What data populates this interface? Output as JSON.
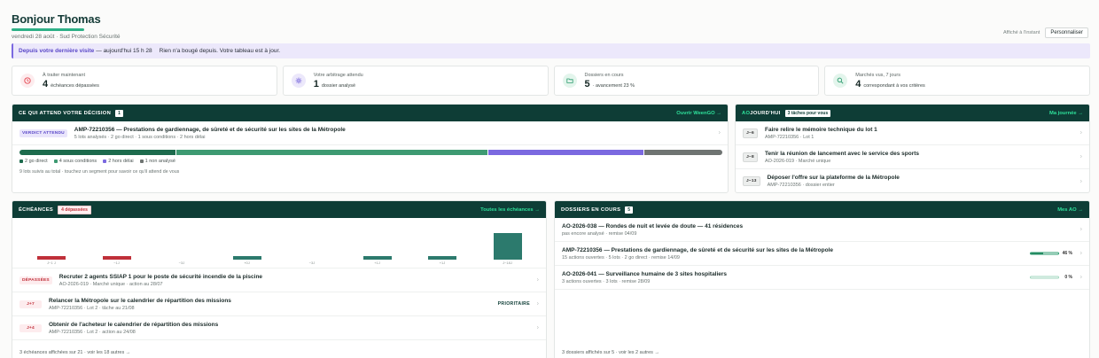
{
  "header": {
    "greeting": "Bonjour Thomas",
    "date": "vendredi 28 août · Sud Protection Sécurité",
    "stamp": "Affiché à l'instant",
    "customize_label": "Personnaliser"
  },
  "banner": {
    "strong": "Depuis votre dernière visite",
    "time": "— aujourd'hui 15 h 28",
    "message": "Rien n'a bougé depuis. Votre tableau est à jour."
  },
  "kpis": [
    {
      "label": "À traiter maintenant",
      "value": "4",
      "sub": "échéances dépassées",
      "icon": "clock-icon",
      "color": "#e54c56",
      "bg": "#fdecee"
    },
    {
      "label": "Votre arbitrage attendu",
      "value": "1",
      "sub": "dossier analysé",
      "icon": "gear-icon",
      "color": "#6a58d8",
      "bg": "#ece8fb"
    },
    {
      "label": "Dossiers en cours",
      "value": "5",
      "sub": "· avancement 23 %",
      "icon": "folder-icon",
      "color": "#2a9a6d",
      "bg": "#e3f5ec"
    },
    {
      "label": "Marchés vus, 7 jours",
      "value": "4",
      "sub": "correspondant à vos critères",
      "icon": "search-icon",
      "color": "#2a9a6d",
      "bg": "#e3f5ec"
    }
  ],
  "decision": {
    "title": "CE QUI ATTEND VOTRE DÉCISION",
    "count": "1",
    "link": "Ouvrir WeenGO →",
    "badge": "VERDICT ATTENDU",
    "row_title": "AMP-72210356 — Prestations de gardiennage, de sûreté et de sécurité sur les sites de la Métropole",
    "row_sub": "5 lots analysés · 2 go direct · 1 sous conditions · 2 hors délai",
    "legend": [
      "2 go direct",
      "4 sous conditions",
      "2 hors délai",
      "1 non analysé"
    ],
    "segments": [
      {
        "share": 2,
        "color": "#1d6b4d"
      },
      {
        "share": 4,
        "color": "#3e9a72"
      },
      {
        "share": 2,
        "color": "#7b69e0"
      },
      {
        "share": 1,
        "color": "#6f7472"
      }
    ],
    "note": "9 lots suivis au total · touchez un segment pour savoir ce qu'il attend de vous"
  },
  "today": {
    "title_hl": "AO",
    "title": "JOURD'HUI",
    "tag": "3 tâches pour vous",
    "link": "Ma journée →",
    "items": [
      {
        "badge": "J−6",
        "title": "Faire relire le mémoire technique du lot 1",
        "sub": "AMP-72210356 · Lot 1"
      },
      {
        "badge": "J−8",
        "title": "Tenir la réunion de lancement avec le service des sports",
        "sub": "AO-2026-019 · Marché unique"
      },
      {
        "badge": "J−13",
        "title": "Déposer l'offre sur la plateforme de la Métropole",
        "sub": "AMP-72210356 · dossier entier"
      }
    ]
  },
  "deadlines": {
    "title": "ÉCHÉANCES",
    "tag": "4 dépassées",
    "link": "Toutes les échéances →",
    "chart_data": {
      "type": "bar",
      "categories": [
        "J−1 J",
        "−1J",
        "−3J",
        "+0J",
        "−3J",
        "+1J",
        "+1J",
        "J−18J"
      ],
      "values": [
        1,
        1,
        0,
        1,
        0,
        1,
        1,
        7
      ],
      "colors": [
        "#c0303a",
        "#c0303a",
        "#2c7a6d",
        "#2c7a6d",
        "#2c7a6d",
        "#2c7a6d",
        "#2c7a6d",
        "#2c7a6d"
      ],
      "ylim": [
        0,
        7
      ]
    },
    "items": [
      {
        "badge": "DÉPASSÉES",
        "badge_style": "red",
        "title": "Recruter 2 agents SSIAP 1 pour le poste de sécurité incendie de la piscine",
        "sub": "AO-2026-019 · Marché unique · action au 28/07",
        "right": ""
      },
      {
        "badge": "J+7",
        "badge_style": "red",
        "title": "Relancer la Métropole sur le calendrier de répartition des missions",
        "sub": "AMP-72210356 · Lot 2 · tâche au 21/08",
        "right": "PRIORITAIRE"
      },
      {
        "badge": "J+4",
        "badge_style": "red",
        "title": "Obtenir de l'acheteur le calendrier de répartition des missions",
        "sub": "AMP-72210356 · Lot 2 · action au 24/08",
        "right": ""
      }
    ],
    "footer": "3 échéances affichées sur 21 · voir les 18 autres →"
  },
  "files": {
    "title": "DOSSIERS EN COURS",
    "count": "5",
    "link": "Mes AO →",
    "items": [
      {
        "title": "AO-2026-038 — Rondes de nuit et levée de doute — 41 résidences",
        "sub": "pas encore analysé · remise 04/09",
        "progress": null,
        "pct": ""
      },
      {
        "title": "AMP-72210356 — Prestations de gardiennage, de sûreté et de sécurité sur les sites de la Métropole",
        "sub": "15 actions ouvertes · 5 lots · 2 go direct · remise 14/09",
        "progress": 0.46,
        "pct": "46 %"
      },
      {
        "title": "AO-2026-041 — Surveillance humaine de 3 sites hospitaliers",
        "sub": "3 actions ouvertes · 3 lots · remise 28/09",
        "progress": 0,
        "pct": "0 %"
      }
    ],
    "footer": "3 dossiers affichés sur 5 · voir les 2 autres →"
  }
}
